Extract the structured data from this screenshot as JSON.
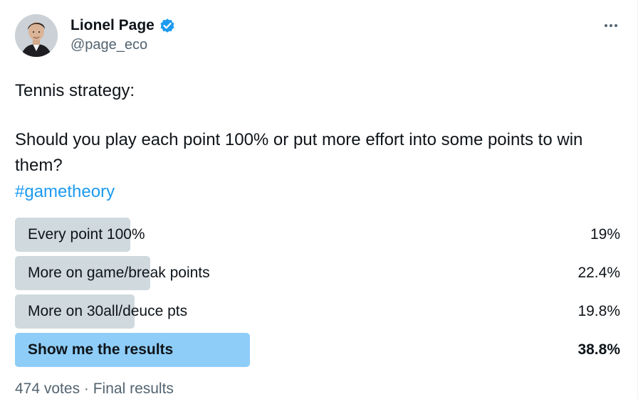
{
  "author": {
    "name": "Lionel Page",
    "handle": "@page_eco"
  },
  "tweet": {
    "line1": "Tennis strategy:",
    "line2": "Should you play each point 100% or put more effort into some points to win them?",
    "hashtag": "#gametheory"
  },
  "poll": {
    "options": [
      {
        "label": "Every point 100%",
        "percent_text": "19%",
        "percent": 19.0
      },
      {
        "label": "More on game/break points",
        "percent_text": "22.4%",
        "percent": 22.4
      },
      {
        "label": "More on 30all/deuce pts",
        "percent_text": "19.8%",
        "percent": 19.8
      },
      {
        "label": "Show me the results",
        "percent_text": "38.8%",
        "percent": 38.8,
        "winner": true
      }
    ],
    "summary": "474 votes · Final results"
  },
  "colors": {
    "accent": "#1d9bf0",
    "bar": "#cfd9de",
    "bar_winner": "#8ecdf8",
    "text": "#0f1419",
    "muted": "#536471"
  },
  "icons": {
    "verified": "verified-badge-icon",
    "more": "more-horizontal-icon"
  }
}
